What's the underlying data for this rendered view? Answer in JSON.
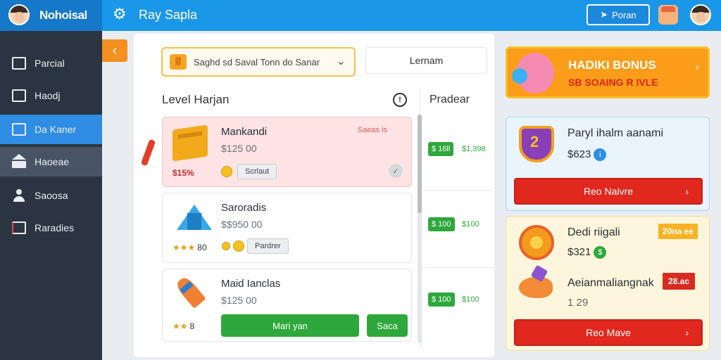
{
  "header": {
    "brand": "Nohoisal",
    "app_title": "Ray Sapla",
    "action_button": "Poran"
  },
  "sidebar": {
    "items": [
      {
        "label": "Parcial"
      },
      {
        "label": "Haodj"
      },
      {
        "label": "Da Kaner"
      },
      {
        "label": "Haoeae"
      },
      {
        "label": "Saoosa"
      },
      {
        "label": "Raradies"
      }
    ]
  },
  "main": {
    "select_value": "Saghd sd Saval Tonn do Sanar",
    "secondary_field": "Lernam",
    "section_title": "Level Harjan",
    "info_label": "!",
    "column_header": "Pradear",
    "cards": [
      {
        "title": "Mankandi",
        "price": "$125 00",
        "tag": "Saeas is",
        "stat": "$15%",
        "action": "Scrlaut"
      },
      {
        "title": "Saroradis",
        "price": "$$950 00",
        "stars": "★★★",
        "stars_count": "80",
        "action": "Pardrer"
      },
      {
        "title": "Maid Ianclas",
        "price": "$125 00",
        "stars": "★★",
        "stars_count": "8",
        "primary_action": "Mari yan",
        "secondary_action": "Saca"
      }
    ],
    "prices": [
      {
        "chip": "$ 16ll",
        "sub": "$1,398"
      },
      {
        "chip": "$ 100",
        "sub": "$100"
      },
      {
        "chip": "$ 100",
        "sub": "$100"
      }
    ]
  },
  "right": {
    "banner": {
      "title": "HADIKI BONUS",
      "subtitle": "SB SOAING R IVLE"
    },
    "offer1": {
      "title": "Paryl ihalm aanami",
      "price": "$623",
      "button": "Reo Naivre"
    },
    "offer2": {
      "title": "Dedi riigali",
      "price": "$321",
      "tag": "20na ee",
      "item_title": "Aeianmaliangnak",
      "item_price": "1 29",
      "item_tag": "28.ac",
      "button": "Reo Mave"
    }
  },
  "colors": {
    "accent": "#1a97e8",
    "sidebar": "#2b3541",
    "active": "#2f8de4",
    "green": "#2ea83c",
    "red": "#e0281e"
  }
}
